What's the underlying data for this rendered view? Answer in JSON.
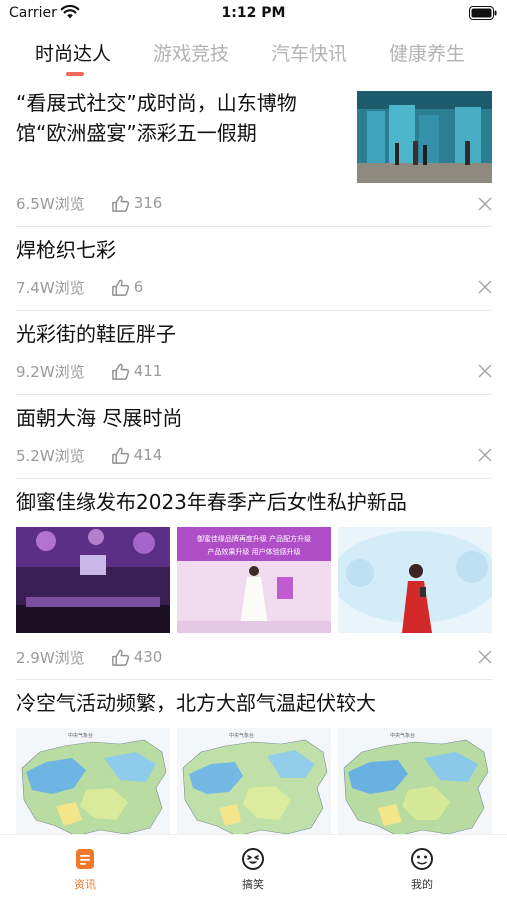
{
  "status_bar": {
    "carrier": "Carrier",
    "time": "1:12 PM"
  },
  "tabs": [
    {
      "label": "时尚达人",
      "active": true
    },
    {
      "label": "游戏竞技",
      "active": false
    },
    {
      "label": "汽车快讯",
      "active": false
    },
    {
      "label": "健康养生",
      "active": false
    }
  ],
  "accent_color": "#f16b5a",
  "articles": [
    {
      "title_line1": "“看展式社交”成时尚，山东博物",
      "title_line2": "馆“欧洲盛宴”添彩五一假期",
      "views": "6.5W浏览",
      "likes": "316"
    },
    {
      "title": "焊枪织七彩",
      "views": "7.4W浏览",
      "likes": "6"
    },
    {
      "title": "光彩街的鞋匠胖子",
      "views": "9.2W浏览",
      "likes": "411"
    },
    {
      "title": "面朝大海 尽展时尚",
      "views": "5.2W浏览",
      "likes": "414"
    },
    {
      "title": "御蜜佳缘发布2023年春季产后女性私护新品",
      "views": "2.9W浏览",
      "likes": "430",
      "banner_line1": "御蜜佳缘品牌再度升级  产品配方升级",
      "banner_line2": "产品效果升级  用户体验感升级"
    },
    {
      "title": "冷空气活动频繁，北方大部气温起伏较大",
      "map_caption": "中央气象台"
    }
  ],
  "bottom_tabs": [
    {
      "label": "资讯",
      "icon": "news-icon",
      "active": true
    },
    {
      "label": "搞笑",
      "icon": "laugh-face-icon",
      "active": false
    },
    {
      "label": "我的",
      "icon": "profile-face-icon",
      "active": false
    }
  ],
  "active_tab_color": "#f0782a"
}
